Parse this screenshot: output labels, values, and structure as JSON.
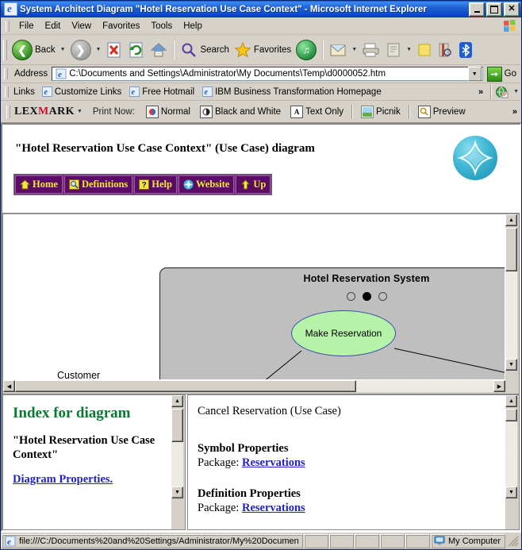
{
  "window": {
    "title": "System Architect Diagram \"Hotel Reservation Use Case Context\" - Microsoft Internet Explorer",
    "minimize_label": "Minimize",
    "maximize_label": "Maximize",
    "close_label": "Close"
  },
  "menu": {
    "items": [
      "File",
      "Edit",
      "View",
      "Favorites",
      "Tools",
      "Help"
    ]
  },
  "toolbar": {
    "back_label": "Back",
    "search_label": "Search",
    "favorites_label": "Favorites"
  },
  "address": {
    "label": "Address",
    "value": "C:\\Documents and Settings\\Administrator\\My Documents\\Temp\\d0000052.htm",
    "go_label": "Go"
  },
  "links": {
    "label": "Links",
    "items": [
      "Customize Links",
      "Free Hotmail",
      "IBM Business Transformation Homepage"
    ],
    "overflow": "»"
  },
  "lexmark": {
    "brand_lex": "LEX",
    "brand_m": "M",
    "brand_ark": "ARK",
    "print_now_label": "Print Now:",
    "items": [
      {
        "label": "Normal",
        "icon": "printer-color-icon"
      },
      {
        "label": "Black and White",
        "icon": "printer-bw-icon"
      },
      {
        "label": "Text Only",
        "icon": "text-only-icon"
      },
      {
        "label": "Picnik",
        "icon": "picnik-icon"
      },
      {
        "label": "Preview",
        "icon": "preview-icon"
      }
    ],
    "overflow": "»"
  },
  "page": {
    "header_title": "\"Hotel Reservation Use Case Context\" (Use Case) diagram",
    "nav_buttons": [
      {
        "label": "Home",
        "icon": "home-icon"
      },
      {
        "label": "Definitions",
        "icon": "definitions-icon"
      },
      {
        "label": "Help",
        "icon": "help-icon"
      },
      {
        "label": "Website",
        "icon": "website-icon"
      },
      {
        "label": "Up",
        "icon": "up-arrow-icon"
      }
    ]
  },
  "diagram": {
    "system_name": "Hotel Reservation System",
    "use_case": "Make Reservation",
    "actor": "Customer",
    "dots": [
      "empty",
      "filled",
      "empty"
    ],
    "system_fill": "#bfbfbf",
    "usecase_fill": "#b6f2a8",
    "usecase_border": "#3a4fa8"
  },
  "index_panel": {
    "title": "Index for diagram",
    "subtitle": "\"Hotel Reservation Use Case Context\"",
    "link": "Diagram Properties."
  },
  "detail_panel": {
    "heading": "Cancel Reservation (Use Case)",
    "symbol_properties_label": "Symbol Properties",
    "symbol_package_label": "Package:",
    "symbol_package_value": "Reservations",
    "definition_properties_label": "Definition Properties",
    "definition_package_label": "Package:",
    "definition_package_value": "Reservations"
  },
  "status": {
    "url": "file:///C:/Documents%20and%20Settings/Administrator/My%20Documen",
    "zone": "My Computer"
  }
}
